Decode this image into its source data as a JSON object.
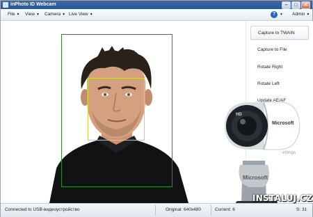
{
  "window": {
    "title": "inPhoto ID Webcam",
    "buttons": {
      "minimize": "–",
      "maximize": "□",
      "close": "✕"
    }
  },
  "menubar": {
    "items": [
      {
        "label": "File",
        "caret": "▼"
      },
      {
        "label": "View",
        "caret": "▼"
      },
      {
        "label": "Camera",
        "caret": "▼"
      },
      {
        "label": "Live View",
        "caret": "▼"
      }
    ],
    "help_label": "?",
    "help_caret": "▼",
    "user": {
      "label": "Admin",
      "caret": "▼"
    }
  },
  "panel": {
    "buttons": [
      {
        "label": "Capture to TWAIN"
      },
      {
        "label": "Capture to File"
      },
      {
        "label": "Rotate Right"
      },
      {
        "label": "Rotate Left"
      },
      {
        "label": "Update AE/AF"
      }
    ],
    "settings_partial": "ettings"
  },
  "statusbar": {
    "connection": "Connected to USB-видеоустройство",
    "original": "Original: 640x480",
    "current": "Current: 6",
    "fps": "S: 31"
  },
  "watermark": {
    "text": "INSTALUJ.CZ"
  },
  "webcam_brand": {
    "label": "Microsoft",
    "hd": "HD"
  },
  "colors": {
    "capture_frame": "#2a8a2a",
    "face_box": "#d8d33a",
    "titlebar": "#2a5590"
  }
}
